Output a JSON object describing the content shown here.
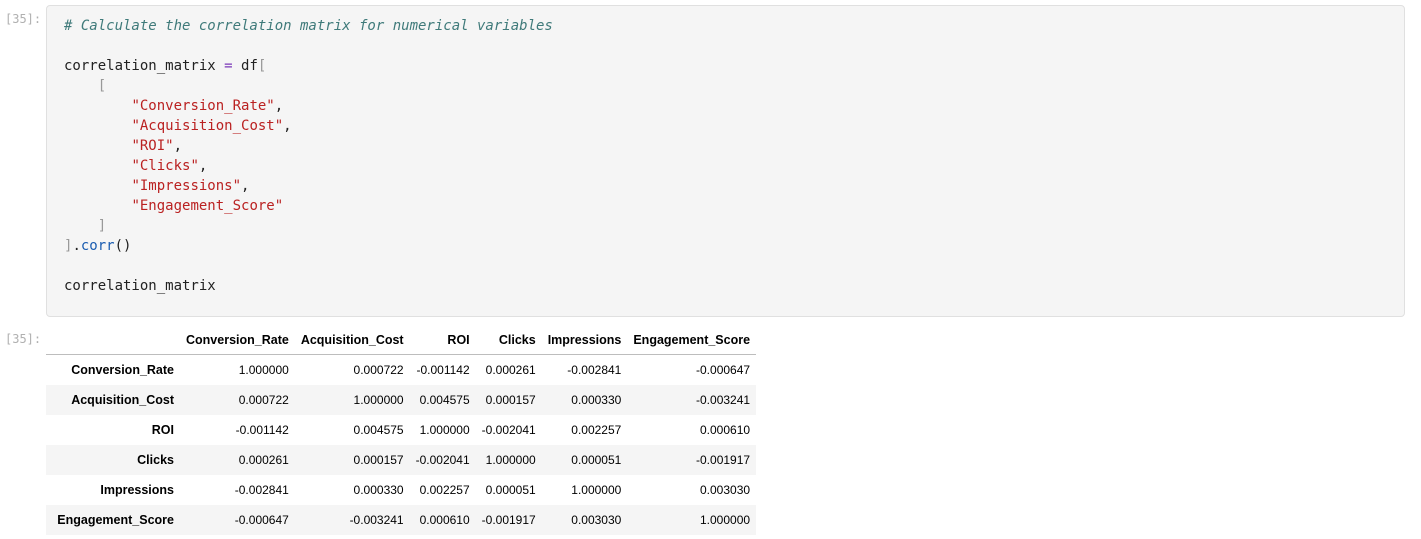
{
  "input_prompt": "[35]:",
  "output_prompt": "[35]:",
  "code": {
    "comment": "# Calculate the correlation matrix for numerical variables",
    "assign_var": "correlation_matrix",
    "assign_op": " = ",
    "df_name": "df",
    "open_bracket": "[",
    "close_bracket": "]",
    "list_open": "[",
    "list_close": "]",
    "columns": [
      "\"Conversion_Rate\"",
      "\"Acquisition_Cost\"",
      "\"ROI\"",
      "\"Clicks\"",
      "\"Impressions\"",
      "\"Engagement_Score\""
    ],
    "comma": ",",
    "method_dot": ".",
    "method": "corr",
    "method_parens": "()",
    "final_line": "correlation_matrix"
  },
  "table": {
    "columns": [
      "Conversion_Rate",
      "Acquisition_Cost",
      "ROI",
      "Clicks",
      "Impressions",
      "Engagement_Score"
    ],
    "rows": [
      {
        "label": "Conversion_Rate",
        "values": [
          "1.000000",
          "0.000722",
          "-0.001142",
          "0.000261",
          "-0.002841",
          "-0.000647"
        ]
      },
      {
        "label": "Acquisition_Cost",
        "values": [
          "0.000722",
          "1.000000",
          "0.004575",
          "0.000157",
          "0.000330",
          "-0.003241"
        ]
      },
      {
        "label": "ROI",
        "values": [
          "-0.001142",
          "0.004575",
          "1.000000",
          "-0.002041",
          "0.002257",
          "0.000610"
        ]
      },
      {
        "label": "Clicks",
        "values": [
          "0.000261",
          "0.000157",
          "-0.002041",
          "1.000000",
          "0.000051",
          "-0.001917"
        ]
      },
      {
        "label": "Impressions",
        "values": [
          "-0.002841",
          "0.000330",
          "0.002257",
          "0.000051",
          "1.000000",
          "0.003030"
        ]
      },
      {
        "label": "Engagement_Score",
        "values": [
          "-0.000647",
          "-0.003241",
          "0.000610",
          "-0.001917",
          "0.003030",
          "1.000000"
        ]
      }
    ]
  }
}
